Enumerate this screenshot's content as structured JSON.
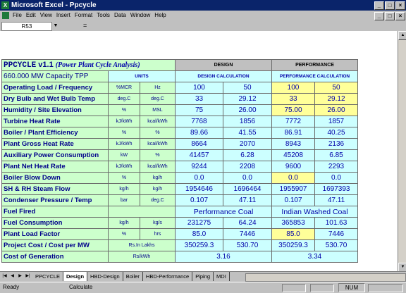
{
  "window": {
    "title": "Microsoft Excel - Ppcycle"
  },
  "menu": [
    "File",
    "Edit",
    "View",
    "Insert",
    "Format",
    "Tools",
    "Data",
    "Window",
    "Help"
  ],
  "formula_bar": {
    "name_box": "R53",
    "eq": "="
  },
  "sheet": {
    "title": {
      "app": "PPCYCLE",
      "version": "v1.1",
      "desc": "(Power Plant Cycle Analysis)"
    },
    "header": {
      "design": "DESIGN",
      "performance": "PERFORMANCE",
      "capacity": "660.000 MW Capacity TPP",
      "units": "UNITS",
      "design_calc": "DESIGN CALCULATION",
      "perf_calc": "PERFORMANCE CALCULATION"
    },
    "rows": [
      {
        "label": "Operating Load / Frequency",
        "u1": "%MCR",
        "u2": "Hz",
        "d1": "100",
        "d2": "50",
        "p1": "100",
        "p2": "50",
        "hl": [
          true,
          true
        ]
      },
      {
        "label": "Dry Bulb and Wet Bulb Temp",
        "u1": "deg.C",
        "u2": "deg.C",
        "d1": "33",
        "d2": "29.12",
        "p1": "33",
        "p2": "29.12",
        "hl": [
          true,
          true
        ]
      },
      {
        "label": "Humidity / Site Elevation",
        "u1": "%",
        "u2": "MSL",
        "d1": "75",
        "d2": "26.00",
        "p1": "75.00",
        "p2": "26.00",
        "hl": [
          true,
          true
        ]
      },
      {
        "label": "Turbine Heat Rate",
        "u1": "kJ/kWh",
        "u2": "kcal/kWh",
        "d1": "7768",
        "d2": "1856",
        "p1": "7772",
        "p2": "1857",
        "hl": [
          false,
          false
        ]
      },
      {
        "label": "Boiler / Plant Efficiency",
        "u1": "%",
        "u2": "%",
        "d1": "89.66",
        "d2": "41.55",
        "p1": "86.91",
        "p2": "40.25",
        "hl": [
          false,
          false
        ]
      },
      {
        "label": "Plant Gross Heat Rate",
        "u1": "kJ/kWh",
        "u2": "kcal/kWh",
        "d1": "8664",
        "d2": "2070",
        "p1": "8943",
        "p2": "2136",
        "hl": [
          false,
          false
        ]
      },
      {
        "label": "Auxiliary Power Consumption",
        "u1": "kW",
        "u2": "%",
        "d1": "41457",
        "d2": "6.28",
        "p1": "45208",
        "p2": "6.85",
        "hl": [
          false,
          false
        ]
      },
      {
        "label": "Plant Net Heat Rate",
        "u1": "kJ/kWh",
        "u2": "kcal/kWh",
        "d1": "9244",
        "d2": "2208",
        "p1": "9600",
        "p2": "2293",
        "hl": [
          false,
          false
        ]
      },
      {
        "label": "Boiler Blow Down",
        "u1": "%",
        "u2": "kg/h",
        "d1": "0.0",
        "d2": "0.0",
        "p1": "0.0",
        "p2": "0.0",
        "hl": [
          true,
          false
        ]
      },
      {
        "label": "SH & RH Steam Flow",
        "u1": "kg/h",
        "u2": "kg/h",
        "d1": "1954646",
        "d2": "1696464",
        "p1": "1955907",
        "p2": "1697393",
        "hl": [
          false,
          false
        ]
      },
      {
        "label": "Condenser Pressure / Temp",
        "u1": "bar",
        "u2": "deg.C",
        "d1": "0.107",
        "d2": "47.11",
        "p1": "0.107",
        "p2": "47.11",
        "hl": [
          false,
          false
        ]
      },
      {
        "type": "fuel",
        "label": "Fuel Fired",
        "design": "Performance Coal",
        "perf": "Indian Washed Coal"
      },
      {
        "label": "Fuel Consumption",
        "u1": "kg/h",
        "u2": "kg/s",
        "d1": "231275",
        "d2": "64.24",
        "p1": "365853",
        "p2": "101.63",
        "hl": [
          false,
          false
        ]
      },
      {
        "label": "Plant Load Factor",
        "u1": "%",
        "u2": "hrs",
        "d1": "85.0",
        "d2": "7446",
        "p1": "85.0",
        "p2": "7446",
        "hl": [
          true,
          false
        ]
      },
      {
        "label": "Project Cost / Cost per MW",
        "u1": "Rs.In Lakhs",
        "span_unit": true,
        "d1": "350259.3",
        "d2": "530.70",
        "p1": "350259.3",
        "p2": "530.70",
        "hl": [
          false,
          false
        ]
      },
      {
        "type": "gen",
        "label": "Cost of Generation",
        "u": "Rs/kWh",
        "design": "3.16",
        "perf": "3.34"
      }
    ]
  },
  "tabs": [
    "PPCYCLE",
    "Design",
    "HBD-Design",
    "Boiler",
    "HBD-Performance",
    "Piping",
    "MDI"
  ],
  "active_tab": "Design",
  "status": {
    "ready": "Ready",
    "calc": "Calculate",
    "num": "NUM"
  }
}
